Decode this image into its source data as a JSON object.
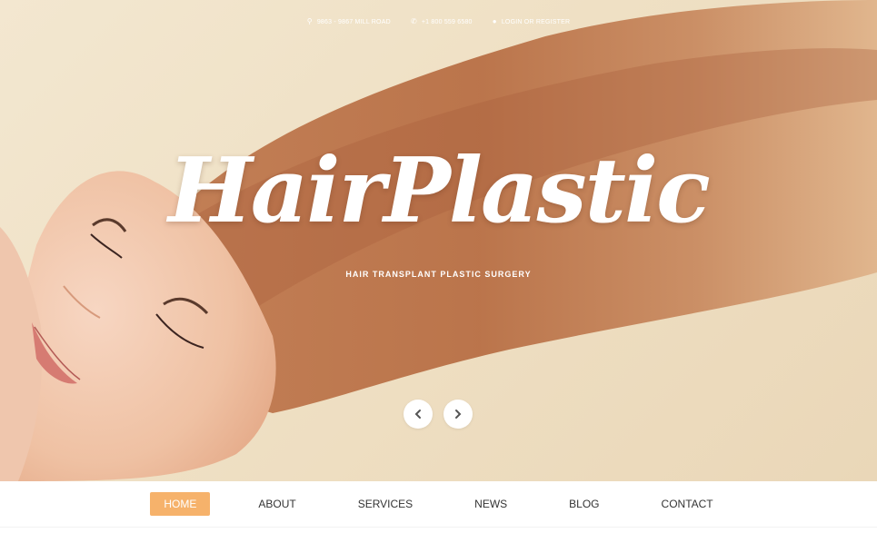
{
  "topbar": {
    "address": "9863 - 9867 MILL ROAD",
    "phone": "+1 800 559 6580",
    "login": "LOGIN OR REGISTER"
  },
  "hero": {
    "logo": "HairPlastic",
    "tagline": "HAIR TRANSPLANT PLASTIC SURGERY"
  },
  "nav": {
    "items": [
      "HOME",
      "ABOUT",
      "SERVICES",
      "NEWS",
      "BLOG",
      "CONTACT"
    ],
    "active": "HOME"
  },
  "icons": {
    "address": "map-pin-icon",
    "phone": "phone-icon",
    "login": "user-icon",
    "prev": "chevron-left-icon",
    "next": "chevron-right-icon"
  },
  "colors": {
    "accent": "#f6b26b",
    "hair": "#b9704a",
    "background": "#efe0c4"
  }
}
